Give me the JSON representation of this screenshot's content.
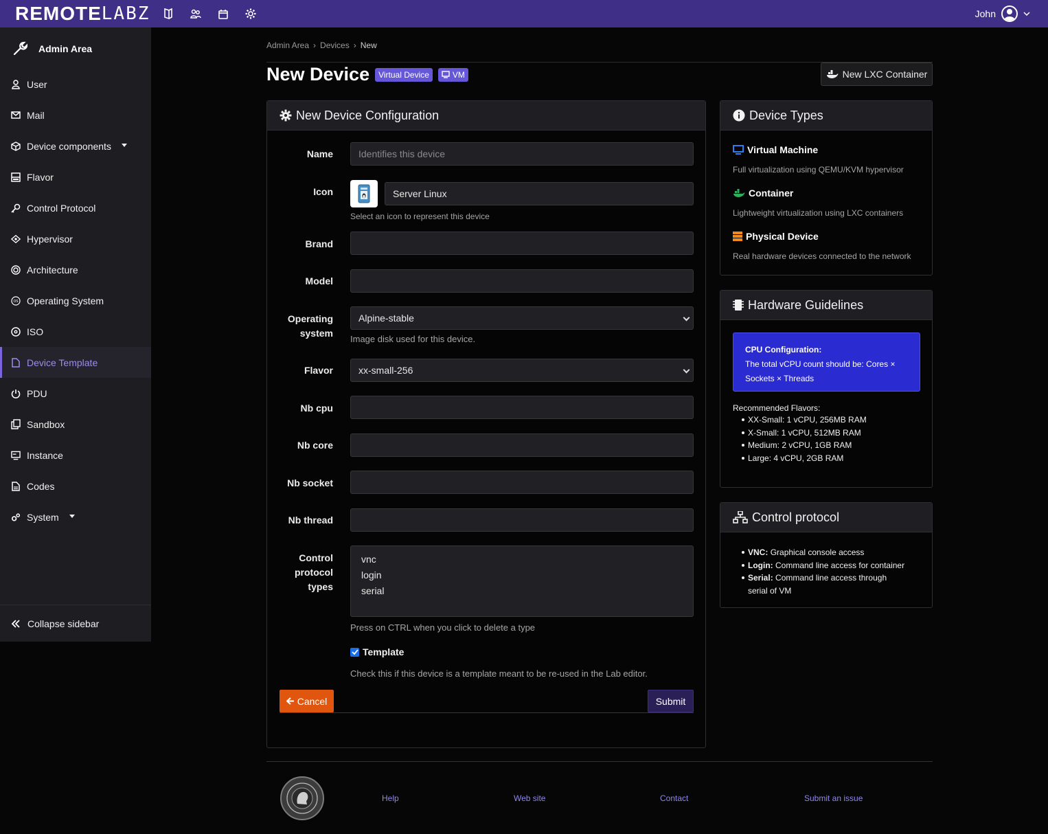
{
  "topbar": {
    "brand_a": "REMOTE",
    "brand_b": "LABZ",
    "user": "John",
    "icons": [
      "book-icon",
      "users-icon",
      "calendar-icon",
      "gear-icon"
    ]
  },
  "sidebar": {
    "header": "Admin Area",
    "items": [
      {
        "label": "User",
        "icon": "user-icon"
      },
      {
        "label": "Mail",
        "icon": "mail-icon"
      },
      {
        "label": "Device components",
        "icon": "cube-icon",
        "dropdown": true
      },
      {
        "label": "Flavor",
        "icon": "flavor-icon"
      },
      {
        "label": "Control Protocol",
        "icon": "key-icon"
      },
      {
        "label": "Hypervisor",
        "icon": "hypervisor-icon"
      },
      {
        "label": "Architecture",
        "icon": "chip-icon"
      },
      {
        "label": "Operating System",
        "icon": "os-icon"
      },
      {
        "label": "ISO",
        "icon": "disc-icon"
      },
      {
        "label": "Device Template",
        "icon": "file-icon",
        "active": true
      },
      {
        "label": "PDU",
        "icon": "power-icon"
      },
      {
        "label": "Sandbox",
        "icon": "copy-icon"
      },
      {
        "label": "Instance",
        "icon": "monitor-icon"
      },
      {
        "label": "Codes",
        "icon": "document-icon"
      },
      {
        "label": "System",
        "icon": "cogs-icon",
        "dropdown": true
      }
    ],
    "collapse": "Collapse sidebar"
  },
  "breadcrumb": [
    "Admin Area",
    "Devices",
    "New"
  ],
  "page": {
    "title": "New Device",
    "badge_virtual": "Virtual Device",
    "badge_vm": "VM",
    "lxc_button": "New LXC Container"
  },
  "form": {
    "heading": "New Device Configuration",
    "name_label": "Name",
    "name_placeholder": "Identifies this device",
    "icon_label": "Icon",
    "icon_value": "Server Linux",
    "icon_help": "Select an icon to represent this device",
    "brand_label": "Brand",
    "model_label": "Model",
    "os_label_1": "Operating",
    "os_label_2": "system",
    "os_value": "Alpine-stable",
    "os_help": "Image disk used for this device.",
    "flavor_label": "Flavor",
    "flavor_value": "xx-small-256",
    "nbcpu_label": "Nb cpu",
    "nbcore_label": "Nb core",
    "nbsocket_label": "Nb socket",
    "nbthread_label": "Nb thread",
    "cp_label_1": "Control",
    "cp_label_2": "protocol",
    "cp_label_3": "types",
    "cp_options": [
      "vnc",
      "login",
      "serial"
    ],
    "cp_help": "Press on CTRL when you click to delete a type",
    "template_label": "Template",
    "template_checked": true,
    "template_help": "Check this if this device is a template meant to be re-used in the Lab editor.",
    "cancel": "Cancel",
    "submit": "Submit"
  },
  "device_types": {
    "heading": "Device Types",
    "items": [
      {
        "title": "Virtual Machine",
        "desc": "Full virtualization using QEMU/KVM hypervisor",
        "icon": "monitor-icon",
        "color": "#2e7bf6"
      },
      {
        "title": "Container",
        "desc": "Lightweight virtualization using LXC containers",
        "icon": "docker-icon",
        "color": "#2fae5b"
      },
      {
        "title": "Physical Device",
        "desc": "Real hardware devices connected to the network",
        "icon": "server-icon",
        "color": "#f08a1d"
      }
    ]
  },
  "hardware": {
    "heading": "Hardware Guidelines",
    "cpu_title": "CPU Configuration:",
    "cpu_text": "The total vCPU count should be: Cores × Sockets × Threads",
    "rec_title": "Recommended Flavors:",
    "flavors": [
      "XX-Small: 1 vCPU, 256MB RAM",
      "X-Small: 1 vCPU, 512MB RAM",
      "Medium: 2 vCPU, 1GB RAM",
      "Large: 4 vCPU, 2GB RAM"
    ]
  },
  "control_protocol": {
    "heading": "Control protocol",
    "items": [
      {
        "name": "VNC:",
        "desc": "Graphical console access"
      },
      {
        "name": "Login:",
        "desc": "Command line access for container"
      },
      {
        "name": "Serial:",
        "desc": "Command line access through serial of VM"
      }
    ]
  },
  "footer": {
    "links": [
      "Help",
      "Web site",
      "Contact",
      "Submit an issue"
    ]
  },
  "colors": {
    "topbar": "#3f2f87",
    "accent": "#6657d8",
    "cancel": "#e0560f",
    "info_box": "#2a2bd0"
  }
}
